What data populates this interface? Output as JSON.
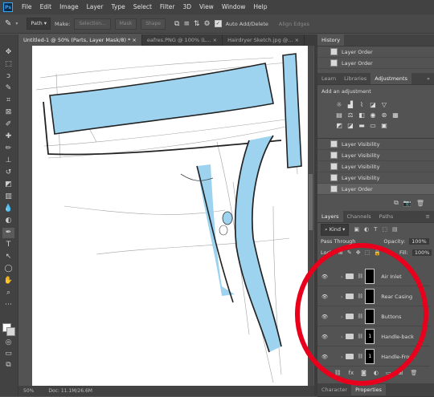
{
  "app": {
    "logo": "Ps"
  },
  "menu": [
    "File",
    "Edit",
    "Image",
    "Layer",
    "Type",
    "Select",
    "Filter",
    "3D",
    "View",
    "Window",
    "Help"
  ],
  "options": {
    "mode": "Path",
    "make_label": "Make:",
    "selection_btn": "Selection...",
    "mask_btn": "Mask",
    "shape_btn": "Shape",
    "auto_add_delete": "Auto Add/Delete",
    "align_edges": "Align Edges"
  },
  "tabs": [
    {
      "label": "Untitled-1 @ 50% (Parts, Layer Mask/8) * ×"
    },
    {
      "label": "eafres.PNG @ 100% (L... ×"
    },
    {
      "label": "Hairdryer Sketch.jpg @... ×"
    }
  ],
  "status": {
    "zoom": "50%",
    "doc": "Doc: 11.1M/26.6M"
  },
  "history": {
    "title": "History",
    "items": [
      "Layer Order",
      "Layer Order"
    ]
  },
  "adjustments": {
    "tabs": [
      "Learn",
      "Libraries",
      "Adjustments"
    ],
    "add_label": "Add an adjustment"
  },
  "history2": {
    "items": [
      "Layer Visibility",
      "Layer Visibility",
      "Layer Visibility",
      "Layer Visibility",
      "Layer Order"
    ]
  },
  "layers": {
    "tabs": [
      "Layers",
      "Channels",
      "Paths"
    ],
    "filter": "Kind",
    "blend_mode": "Pass Through",
    "opacity_label": "Opacity:",
    "opacity": "100%",
    "lock_label": "Lock:",
    "fill_label": "Fill:",
    "fill": "100%",
    "items": [
      {
        "name": "Air Inlet",
        "mask": ""
      },
      {
        "name": "Rear Casing",
        "mask": ""
      },
      {
        "name": "Buttons",
        "mask": ""
      },
      {
        "name": "Handle-back",
        "mask": "1"
      },
      {
        "name": "Handle-Front",
        "mask": "1"
      }
    ]
  },
  "bottom_tabs": [
    "Character",
    "Properties"
  ],
  "colors": {
    "fill_blue": "#9dd3ef",
    "annotation_red": "#e8001c"
  }
}
